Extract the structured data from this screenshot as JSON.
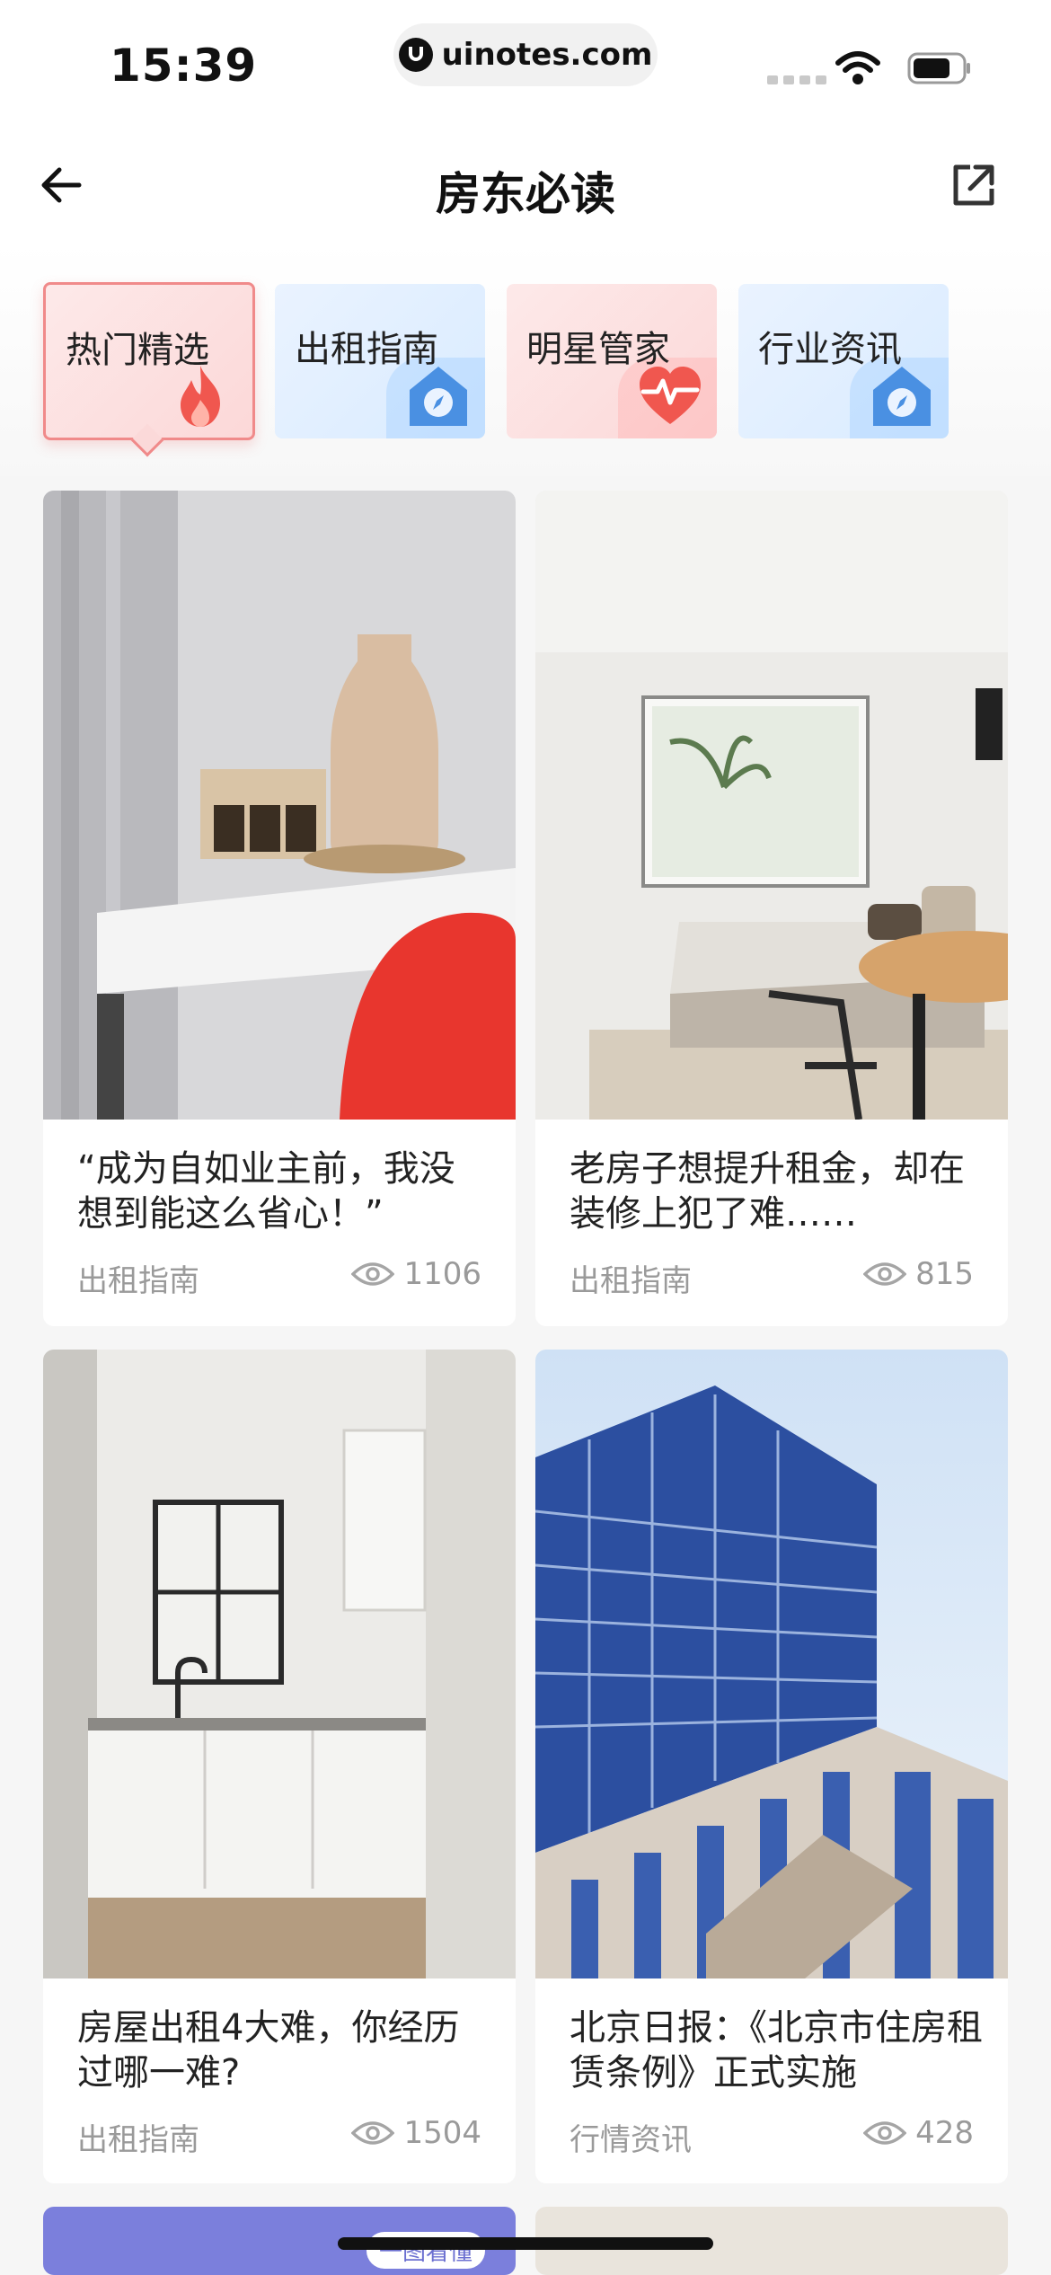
{
  "status_bar": {
    "time": "15:39",
    "url": "uinotes.com"
  },
  "nav": {
    "title": "房东必读",
    "back_icon": "arrow-left-icon",
    "share_icon": "external-link-icon"
  },
  "tabs": [
    {
      "label": "热门精选",
      "icon": "flame-icon",
      "active": true
    },
    {
      "label": "出租指南",
      "icon": "compass-house-icon",
      "active": false
    },
    {
      "label": "明星管家",
      "icon": "heart-pulse-icon",
      "active": false
    },
    {
      "label": "行业资讯",
      "icon": "compass-house-icon",
      "active": false
    }
  ],
  "cards": [
    {
      "title": "“成为自如业主前，我没想到能这么省心！”",
      "category": "出租指南",
      "views": "1106"
    },
    {
      "title": "老房子想提升租金，却在装修上犯了难……",
      "category": "出租指南",
      "views": "815"
    },
    {
      "title": "房屋出租4大难，你经历过哪一难?",
      "category": "出租指南",
      "views": "1504"
    },
    {
      "title": "北京日报：《北京市住房租赁条例》正式实施",
      "category": "行情资讯",
      "views": "428"
    }
  ],
  "partial_card_badge": "一图看懂",
  "colors": {
    "accent_red": "#f0574f",
    "accent_blue": "#4a90e2",
    "muted": "#9a9a9a"
  }
}
